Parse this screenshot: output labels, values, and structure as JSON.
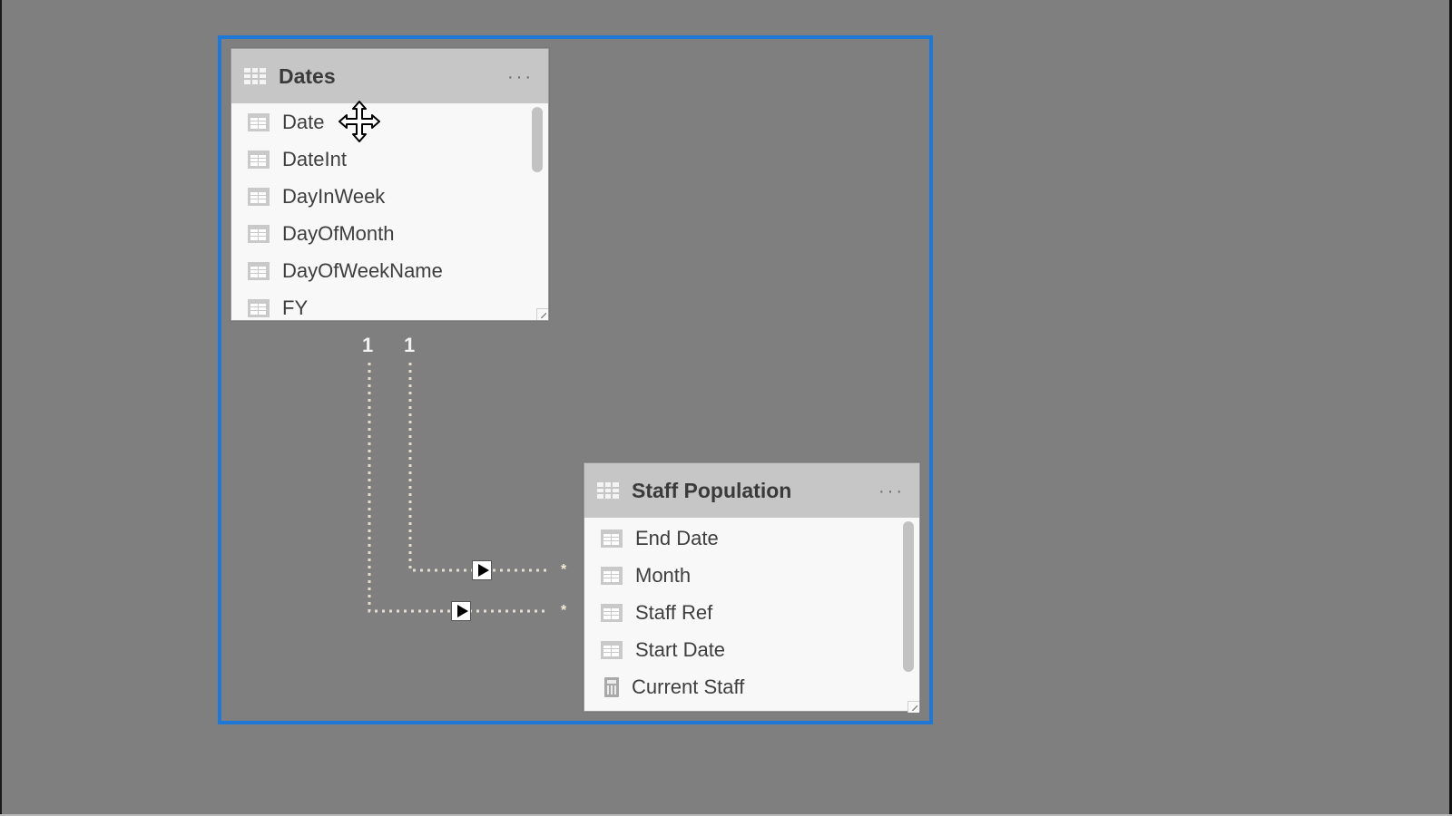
{
  "tables": [
    {
      "name": "Dates",
      "menu_label": "···",
      "fields": [
        {
          "label": "Date",
          "type": "column"
        },
        {
          "label": "DateInt",
          "type": "column"
        },
        {
          "label": "DayInWeek",
          "type": "column"
        },
        {
          "label": "DayOfMonth",
          "type": "column"
        },
        {
          "label": "DayOfWeekName",
          "type": "column"
        },
        {
          "label": "FY",
          "type": "column"
        }
      ]
    },
    {
      "name": "Staff Population",
      "menu_label": "···",
      "fields": [
        {
          "label": "End Date",
          "type": "column"
        },
        {
          "label": "Month",
          "type": "column"
        },
        {
          "label": "Staff Ref",
          "type": "column"
        },
        {
          "label": "Start Date",
          "type": "column"
        },
        {
          "label": "Current Staff",
          "type": "measure"
        }
      ]
    }
  ],
  "relationships": [
    {
      "from_table": "Staff Population",
      "to_table": "Dates",
      "one_label": "1",
      "many_label": "*",
      "direction": "single"
    },
    {
      "from_table": "Staff Population",
      "to_table": "Dates",
      "one_label": "1",
      "many_label": "*",
      "direction": "single"
    }
  ],
  "colors": {
    "canvas": "#7f7f7f",
    "selection_frame": "#1e78d7",
    "card_header": "#c6c6c6",
    "card_body": "#f8f8f8"
  },
  "cursor": "move-cursor"
}
